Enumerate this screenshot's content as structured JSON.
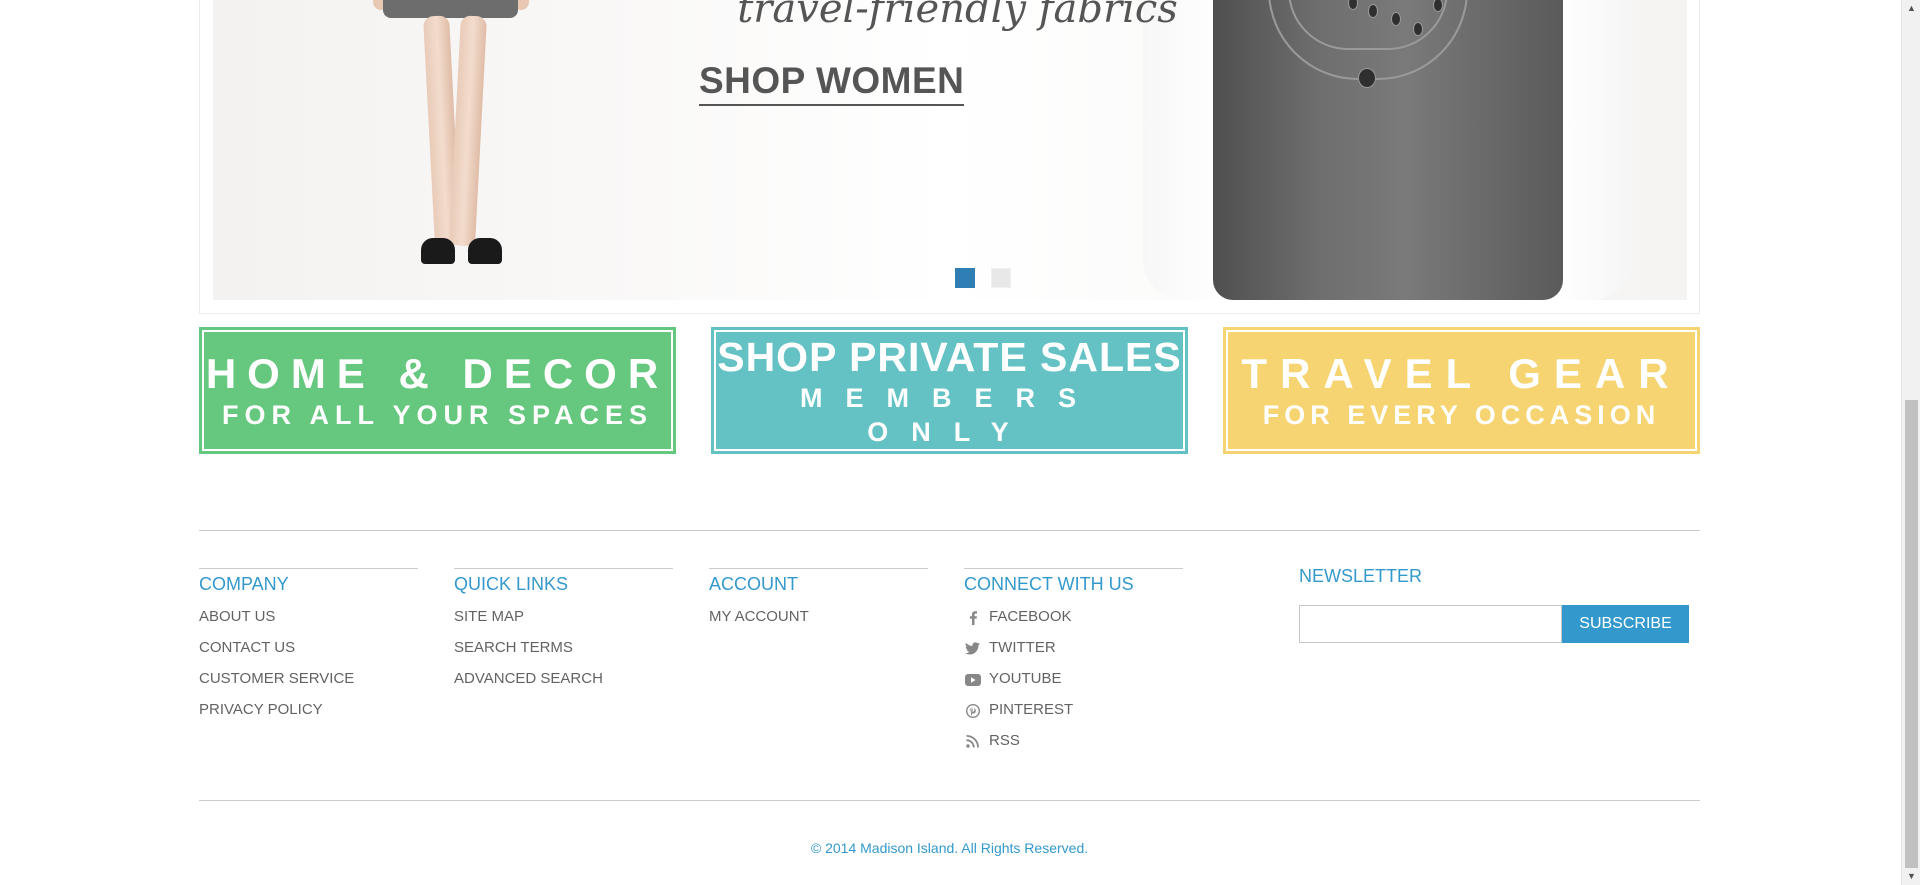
{
  "hero": {
    "tagline": "travel-friendly fabrics",
    "cta_label": "SHOP WOMEN",
    "slide_count": 2,
    "active_slide": 1
  },
  "promos": [
    {
      "line1": "HOME & DECOR",
      "line2": "FOR ALL YOUR SPACES",
      "color": "#66c77e"
    },
    {
      "line1": "SHOP PRIVATE SALES",
      "line2": "MEMBERS ONLY",
      "color": "#64c2c4"
    },
    {
      "line1": "TRAVEL GEAR",
      "line2": "FOR EVERY OCCASION",
      "color": "#f5d471"
    }
  ],
  "footer": {
    "company": {
      "title": "COMPANY",
      "links": [
        "ABOUT US",
        "CONTACT US",
        "CUSTOMER SERVICE",
        "PRIVACY POLICY"
      ]
    },
    "quick_links": {
      "title": "QUICK LINKS",
      "links": [
        "SITE MAP",
        "SEARCH TERMS",
        "ADVANCED SEARCH"
      ]
    },
    "account": {
      "title": "ACCOUNT",
      "links": [
        "MY ACCOUNT"
      ]
    },
    "connect": {
      "title": "CONNECT WITH US",
      "links": [
        {
          "label": "FACEBOOK",
          "icon": "facebook-icon"
        },
        {
          "label": "TWITTER",
          "icon": "twitter-icon"
        },
        {
          "label": "YOUTUBE",
          "icon": "youtube-icon"
        },
        {
          "label": "PINTEREST",
          "icon": "pinterest-icon"
        },
        {
          "label": "RSS",
          "icon": "rss-icon"
        }
      ]
    },
    "newsletter": {
      "title": "NEWSLETTER",
      "input_value": "",
      "button_label": "SUBSCRIBE"
    },
    "copyright": "© 2014 Madison Island. All Rights Reserved."
  },
  "colors": {
    "accent": "#3399cc",
    "slider_active_dot": "#2f7fb5"
  }
}
